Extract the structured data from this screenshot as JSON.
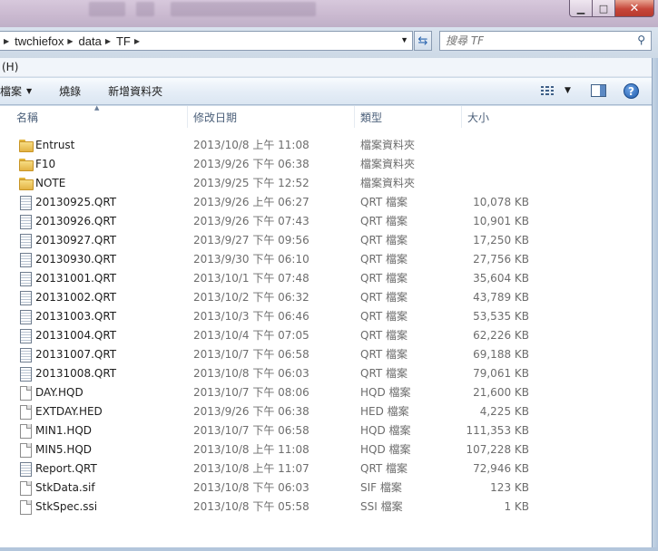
{
  "window": {
    "min_glyph": "▁",
    "max_glyph": "□",
    "close_glyph": "✕"
  },
  "address": {
    "crumbs": [
      "twchiefox",
      "data",
      "TF"
    ]
  },
  "search": {
    "placeholder": "搜尋 TF"
  },
  "menu": {
    "item": "(H)"
  },
  "toolbar": {
    "btn1": "開啟舊檔",
    "btn1_visible": "檔案",
    "btn2": "燒錄",
    "btn3": "新增資料夾"
  },
  "columns": {
    "name": "名稱",
    "date": "修改日期",
    "type": "類型",
    "size": "大小"
  },
  "files": [
    {
      "name": "Entrust",
      "date": "2013/10/8 上午 11:08",
      "type": "檔案資料夾",
      "size": "",
      "icon": "folder"
    },
    {
      "name": "F10",
      "date": "2013/9/26 下午 06:38",
      "type": "檔案資料夾",
      "size": "",
      "icon": "folder"
    },
    {
      "name": "NOTE",
      "date": "2013/9/25 下午 12:52",
      "type": "檔案資料夾",
      "size": "",
      "icon": "folder"
    },
    {
      "name": "20130925.QRT",
      "date": "2013/9/26 上午 06:27",
      "type": "QRT 檔案",
      "size": "10,078 KB",
      "icon": "doc"
    },
    {
      "name": "20130926.QRT",
      "date": "2013/9/26 下午 07:43",
      "type": "QRT 檔案",
      "size": "10,901 KB",
      "icon": "doc"
    },
    {
      "name": "20130927.QRT",
      "date": "2013/9/27 下午 09:56",
      "type": "QRT 檔案",
      "size": "17,250 KB",
      "icon": "doc"
    },
    {
      "name": "20130930.QRT",
      "date": "2013/9/30 下午 06:10",
      "type": "QRT 檔案",
      "size": "27,756 KB",
      "icon": "doc"
    },
    {
      "name": "20131001.QRT",
      "date": "2013/10/1 下午 07:48",
      "type": "QRT 檔案",
      "size": "35,604 KB",
      "icon": "doc"
    },
    {
      "name": "20131002.QRT",
      "date": "2013/10/2 下午 06:32",
      "type": "QRT 檔案",
      "size": "43,789 KB",
      "icon": "doc"
    },
    {
      "name": "20131003.QRT",
      "date": "2013/10/3 下午 06:46",
      "type": "QRT 檔案",
      "size": "53,535 KB",
      "icon": "doc"
    },
    {
      "name": "20131004.QRT",
      "date": "2013/10/4 下午 07:05",
      "type": "QRT 檔案",
      "size": "62,226 KB",
      "icon": "doc"
    },
    {
      "name": "20131007.QRT",
      "date": "2013/10/7 下午 06:58",
      "type": "QRT 檔案",
      "size": "69,188 KB",
      "icon": "doc"
    },
    {
      "name": "20131008.QRT",
      "date": "2013/10/8 下午 06:03",
      "type": "QRT 檔案",
      "size": "79,061 KB",
      "icon": "doc"
    },
    {
      "name": "DAY.HQD",
      "date": "2013/10/7 下午 08:06",
      "type": "HQD 檔案",
      "size": "21,600 KB",
      "icon": "file"
    },
    {
      "name": "EXTDAY.HED",
      "date": "2013/9/26 下午 06:38",
      "type": "HED 檔案",
      "size": "4,225 KB",
      "icon": "file"
    },
    {
      "name": "MIN1.HQD",
      "date": "2013/10/7 下午 06:58",
      "type": "HQD 檔案",
      "size": "111,353 KB",
      "icon": "file"
    },
    {
      "name": "MIN5.HQD",
      "date": "2013/10/8 上午 11:08",
      "type": "HQD 檔案",
      "size": "107,228 KB",
      "icon": "file"
    },
    {
      "name": "Report.QRT",
      "date": "2013/10/8 上午 11:07",
      "type": "QRT 檔案",
      "size": "72,946 KB",
      "icon": "doc"
    },
    {
      "name": "StkData.sif",
      "date": "2013/10/8 下午 06:03",
      "type": "SIF 檔案",
      "size": "123 KB",
      "icon": "file"
    },
    {
      "name": "StkSpec.ssi",
      "date": "2013/10/8 下午 05:58",
      "type": "SSI 檔案",
      "size": "1 KB",
      "icon": "file"
    }
  ]
}
